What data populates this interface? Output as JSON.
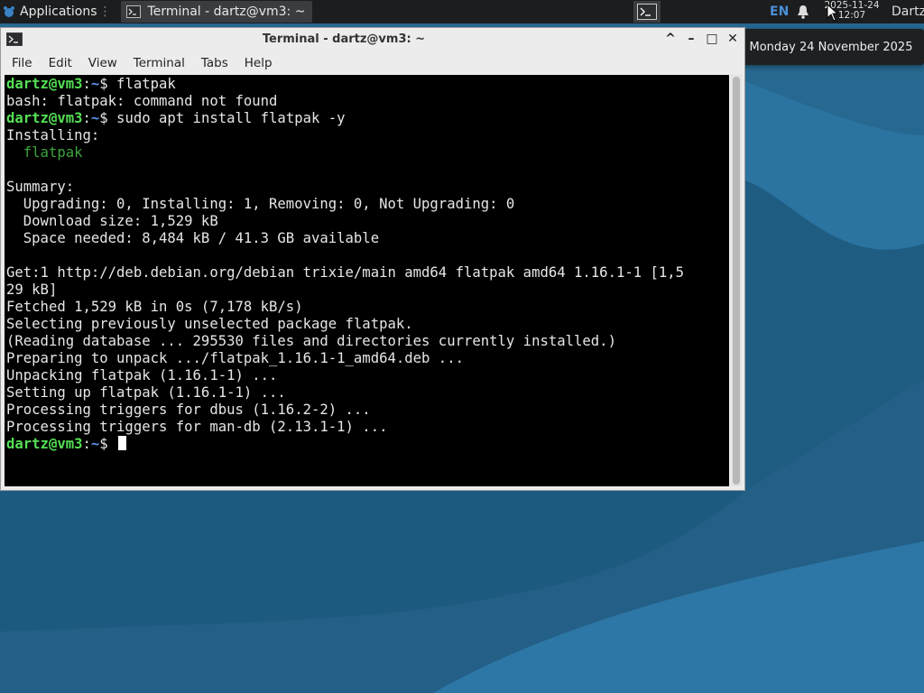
{
  "panel": {
    "applications_label": "Applications",
    "applications_sep": "⋮",
    "task_title": "Terminal - dartz@vm3: ~",
    "lang": "EN",
    "clock_date": "2025-11-24",
    "clock_time": "12:07",
    "user": "Dartz"
  },
  "tooltip": {
    "text": "Monday 24 November 2025"
  },
  "window": {
    "title": "Terminal - dartz@vm3: ~",
    "controls": {
      "up": "^",
      "minimize": "–",
      "maximize": "□",
      "close": "✕"
    },
    "menu": [
      "File",
      "Edit",
      "View",
      "Terminal",
      "Tabs",
      "Help"
    ]
  },
  "terminal": {
    "prompt_user": "dartz@vm3",
    "prompt_path": "~",
    "lines": [
      {
        "kind": "prompt",
        "cmd": " flatpak"
      },
      {
        "kind": "text",
        "text": "bash: flatpak: command not found"
      },
      {
        "kind": "prompt",
        "cmd": " sudo apt install flatpak -y"
      },
      {
        "kind": "text",
        "text": "Installing:"
      },
      {
        "kind": "pkg",
        "text": "  flatpak"
      },
      {
        "kind": "text",
        "text": ""
      },
      {
        "kind": "text",
        "text": "Summary:"
      },
      {
        "kind": "text",
        "text": "  Upgrading: 0, Installing: 1, Removing: 0, Not Upgrading: 0"
      },
      {
        "kind": "text",
        "text": "  Download size: 1,529 kB"
      },
      {
        "kind": "text",
        "text": "  Space needed: 8,484 kB / 41.3 GB available"
      },
      {
        "kind": "text",
        "text": ""
      },
      {
        "kind": "text",
        "text": "Get:1 http://deb.debian.org/debian trixie/main amd64 flatpak amd64 1.16.1-1 [1,5"
      },
      {
        "kind": "text",
        "text": "29 kB]"
      },
      {
        "kind": "text",
        "text": "Fetched 1,529 kB in 0s (7,178 kB/s)"
      },
      {
        "kind": "text",
        "text": "Selecting previously unselected package flatpak."
      },
      {
        "kind": "text",
        "text": "(Reading database ... 295530 files and directories currently installed.)"
      },
      {
        "kind": "text",
        "text": "Preparing to unpack .../flatpak_1.16.1-1_amd64.deb ..."
      },
      {
        "kind": "text",
        "text": "Unpacking flatpak (1.16.1-1) ..."
      },
      {
        "kind": "text",
        "text": "Setting up flatpak (1.16.1-1) ..."
      },
      {
        "kind": "text",
        "text": "Processing triggers for dbus (1.16.2-2) ..."
      },
      {
        "kind": "text",
        "text": "Processing triggers for man-db (2.13.1-1) ..."
      },
      {
        "kind": "cursor",
        "cmd": " "
      }
    ]
  },
  "colors": {
    "prompt_user": "#55e055",
    "prompt_path": "#5c8ee8",
    "package": "#3ca53c",
    "desktop_bg": "#1f5f86"
  }
}
